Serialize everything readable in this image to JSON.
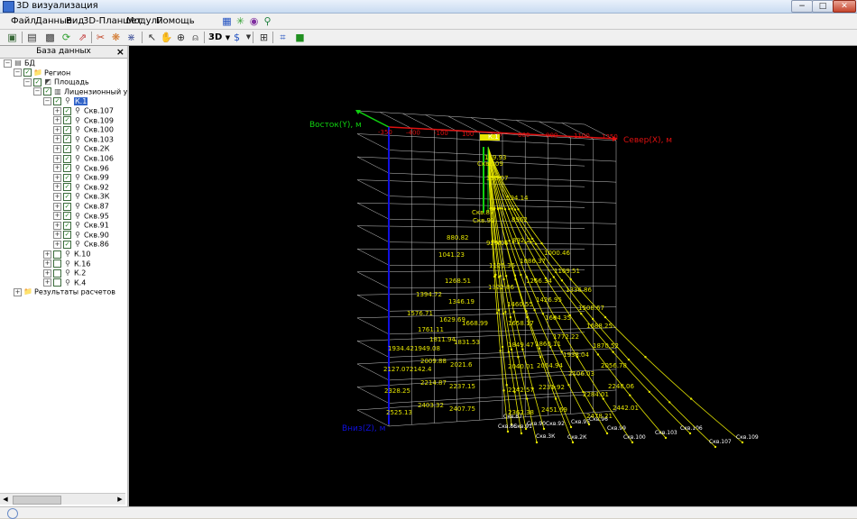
{
  "window": {
    "title": "3D визуализация",
    "app_icon": "3d-app-icon",
    "minimize": "−",
    "maximize": "□",
    "close": "✕"
  },
  "menu": {
    "items": [
      {
        "label": "Файл"
      },
      {
        "label": "Данные"
      },
      {
        "label": "Вид"
      },
      {
        "label": "3D-Планшет"
      },
      {
        "label": "Модули"
      },
      {
        "label": "Помощь"
      }
    ],
    "icons": [
      "grid-icon",
      "network-icon",
      "globe-icon",
      "wells-icon"
    ]
  },
  "toolbar": {
    "buttons": [
      "new-icon",
      "layers-icon",
      "save-icon",
      "refresh-icon",
      "export-icon",
      "cut-icon",
      "pattern-icon",
      "filter-icon",
      "pointer-icon",
      "hand-icon",
      "zoom-icon",
      "measure-icon"
    ],
    "dropdown_label": "3D",
    "dropdown_arrow": "▼",
    "extra_buttons": [
      "rotate-icon",
      "zoom-window-icon",
      "snapshot-icon",
      "print-icon",
      "color-icon"
    ]
  },
  "panel": {
    "title": "База данных",
    "close": "×",
    "tree": [
      {
        "label": "БД",
        "level": 0,
        "expander": "−",
        "icon": "database-icon",
        "checked": null
      },
      {
        "label": "Регион",
        "level": 1,
        "expander": "−",
        "icon": "folder-icon",
        "checked": true
      },
      {
        "label": "Площадь",
        "level": 2,
        "expander": "−",
        "icon": "area-icon",
        "checked": true
      },
      {
        "label": "Лицензионный участок",
        "level": 3,
        "expander": "−",
        "icon": "license-icon",
        "checked": true
      },
      {
        "label": "К.1",
        "level": 4,
        "expander": "−",
        "icon": "pad-icon",
        "checked": true,
        "selected": true
      },
      {
        "label": "Скв.107",
        "level": 5,
        "expander": "+",
        "icon": "well-icon",
        "checked": true
      },
      {
        "label": "Скв.109",
        "level": 5,
        "expander": "+",
        "icon": "well-icon",
        "checked": true
      },
      {
        "label": "Скв.100",
        "level": 5,
        "expander": "+",
        "icon": "well-icon",
        "checked": true
      },
      {
        "label": "Скв.103",
        "level": 5,
        "expander": "+",
        "icon": "well-icon",
        "checked": true
      },
      {
        "label": "Скв.2К",
        "level": 5,
        "expander": "+",
        "icon": "well-icon",
        "checked": true
      },
      {
        "label": "Скв.106",
        "level": 5,
        "expander": "+",
        "icon": "well-icon",
        "checked": true
      },
      {
        "label": "Скв.96",
        "level": 5,
        "expander": "+",
        "icon": "well-icon",
        "checked": true
      },
      {
        "label": "Скв.99",
        "level": 5,
        "expander": "+",
        "icon": "well-icon",
        "checked": true
      },
      {
        "label": "Скв.92",
        "level": 5,
        "expander": "+",
        "icon": "well-icon",
        "checked": true
      },
      {
        "label": "Скв.3К",
        "level": 5,
        "expander": "+",
        "icon": "well-icon",
        "checked": true
      },
      {
        "label": "Скв.87",
        "level": 5,
        "expander": "+",
        "icon": "well-icon",
        "checked": true
      },
      {
        "label": "Скв.95",
        "level": 5,
        "expander": "+",
        "icon": "well-icon",
        "checked": true
      },
      {
        "label": "Скв.91",
        "level": 5,
        "expander": "+",
        "icon": "well-icon",
        "checked": true
      },
      {
        "label": "Скв.90",
        "level": 5,
        "expander": "+",
        "icon": "well-icon",
        "checked": true
      },
      {
        "label": "Скв.86",
        "level": 5,
        "expander": "+",
        "icon": "well-icon",
        "checked": true
      },
      {
        "label": "К.10",
        "level": 4,
        "expander": "+",
        "icon": "pad-icon",
        "checked": false
      },
      {
        "label": "К.16",
        "level": 4,
        "expander": "+",
        "icon": "pad-icon",
        "checked": false
      },
      {
        "label": "К.2",
        "level": 4,
        "expander": "+",
        "icon": "pad-icon",
        "checked": false
      },
      {
        "label": "К.4",
        "level": 4,
        "expander": "+",
        "icon": "pad-icon",
        "checked": false
      },
      {
        "label": "Результаты расчетов",
        "level": 1,
        "expander": "+",
        "icon": "folder-icon",
        "checked": null
      }
    ]
  },
  "view3d": {
    "axis_east": "Восток(Y), м",
    "axis_north": "Север(X), м",
    "axis_depth": "Вниз(Z), м",
    "x_ticks": [
      "-350",
      "-400",
      "-100",
      "100",
      "300",
      "600",
      "900",
      "1100",
      "1350"
    ],
    "colors": {
      "background": "#000000",
      "grid": "#c8c8c8",
      "trajectory": "#e6e600",
      "x_axis": "#e01010",
      "y_axis": "#10d010",
      "z_axis": "#1010e0"
    },
    "pad_label": "К.1",
    "wells": [
      {
        "label": "Скв.87",
        "end": [
          424,
          420
        ],
        "lx": 415,
        "ly": 413
      },
      {
        "label": "Скв.86",
        "end": [
          420,
          428
        ],
        "lx": 409,
        "ly": 424
      },
      {
        "label": "Скв.90",
        "end": [
          440,
          425
        ],
        "lx": 441,
        "ly": 421
      },
      {
        "label": "Скв.92",
        "end": [
          460,
          425
        ],
        "lx": 462,
        "ly": 421
      },
      {
        "label": "Скв.3К",
        "end": [
          452,
          440
        ],
        "lx": 451,
        "ly": 435
      },
      {
        "label": "Скв.95",
        "end": [
          490,
          423
        ],
        "lx": 490,
        "ly": 419
      },
      {
        "label": "Скв.96",
        "end": [
          510,
          420
        ],
        "lx": 510,
        "ly": 416
      },
      {
        "label": "Скв.2К",
        "end": [
          492,
          440
        ],
        "lx": 486,
        "ly": 436
      },
      {
        "label": "Скв.99",
        "end": [
          530,
          430
        ],
        "lx": 530,
        "ly": 426
      },
      {
        "label": "Скв.100",
        "end": [
          558,
          440
        ],
        "lx": 548,
        "ly": 436
      },
      {
        "label": "Скв.103",
        "end": [
          595,
          435
        ],
        "lx": 583,
        "ly": 431
      },
      {
        "label": "Скв.106",
        "end": [
          622,
          430
        ],
        "lx": 611,
        "ly": 426
      },
      {
        "label": "Скв.107",
        "end": [
          650,
          445
        ],
        "lx": 643,
        "ly": 441
      },
      {
        "label": "Скв.109",
        "end": [
          680,
          440
        ],
        "lx": 673,
        "ly": 436
      },
      {
        "label": "Скв.91",
        "end": [
          435,
          430
        ],
        "lx": 426,
        "ly": 424
      }
    ],
    "depth_labels": [
      {
        "t": "119.93",
        "x": 394,
        "y": 126
      },
      {
        "t": "Скв.109",
        "x": 386,
        "y": 133
      },
      {
        "t": "310.07",
        "x": 396,
        "y": 149
      },
      {
        "t": "594.14",
        "x": 418,
        "y": 171
      },
      {
        "t": "Скв.87",
        "x": 380,
        "y": 187
      },
      {
        "t": "Скв.91",
        "x": 381,
        "y": 196
      },
      {
        "t": "8962",
        "x": 424,
        "y": 195
      },
      {
        "t": "880.82",
        "x": 352,
        "y": 215
      },
      {
        "t": "929.06",
        "x": 396,
        "y": 221
      },
      {
        "t": "892.25",
        "x": 425,
        "y": 218
      },
      {
        "t": "1000.46",
        "x": 460,
        "y": 232
      },
      {
        "t": "1041.23",
        "x": 343,
        "y": 234
      },
      {
        "t": "1086.37",
        "x": 433,
        "y": 241
      },
      {
        "t": "1125.36",
        "x": 399,
        "y": 246
      },
      {
        "t": "1169.51",
        "x": 471,
        "y": 252
      },
      {
        "t": "1268.51",
        "x": 350,
        "y": 263
      },
      {
        "t": "1266.34",
        "x": 440,
        "y": 263
      },
      {
        "t": "1336.86",
        "x": 484,
        "y": 273
      },
      {
        "t": "1322.86",
        "x": 398,
        "y": 270
      },
      {
        "t": "1394.72",
        "x": 318,
        "y": 278
      },
      {
        "t": "1346.19",
        "x": 354,
        "y": 286
      },
      {
        "t": "1426.95",
        "x": 451,
        "y": 284
      },
      {
        "t": "1460.55",
        "x": 419,
        "y": 289
      },
      {
        "t": "1508.67",
        "x": 498,
        "y": 293
      },
      {
        "t": "1576.71",
        "x": 308,
        "y": 299
      },
      {
        "t": "1629.69",
        "x": 344,
        "y": 306
      },
      {
        "t": "1668.99",
        "x": 369,
        "y": 310
      },
      {
        "t": "1604.35",
        "x": 461,
        "y": 304
      },
      {
        "t": "1658.17",
        "x": 420,
        "y": 310
      },
      {
        "t": "1688.25",
        "x": 507,
        "y": 313
      },
      {
        "t": "1761.11",
        "x": 320,
        "y": 317
      },
      {
        "t": "1772.22",
        "x": 470,
        "y": 325
      },
      {
        "t": "1811.94",
        "x": 333,
        "y": 328
      },
      {
        "t": "1831.53",
        "x": 360,
        "y": 331
      },
      {
        "t": "1849.47",
        "x": 420,
        "y": 334
      },
      {
        "t": "1860.11",
        "x": 450,
        "y": 333
      },
      {
        "t": "1870.52",
        "x": 514,
        "y": 335
      },
      {
        "t": "1934.42",
        "x": 287,
        "y": 338
      },
      {
        "t": "1949.08",
        "x": 316,
        "y": 338
      },
      {
        "t": "1938.04",
        "x": 481,
        "y": 345
      },
      {
        "t": "2009.88",
        "x": 323,
        "y": 352
      },
      {
        "t": "2021.6",
        "x": 356,
        "y": 356
      },
      {
        "t": "2040.01",
        "x": 420,
        "y": 358
      },
      {
        "t": "2064.94",
        "x": 452,
        "y": 357
      },
      {
        "t": "2056.78",
        "x": 523,
        "y": 357
      },
      {
        "t": "2127.07",
        "x": 282,
        "y": 361
      },
      {
        "t": "2142.4",
        "x": 311,
        "y": 361
      },
      {
        "t": "2106.03",
        "x": 487,
        "y": 366
      },
      {
        "t": "2214.87",
        "x": 323,
        "y": 376
      },
      {
        "t": "2237.15",
        "x": 355,
        "y": 380
      },
      {
        "t": "2242.57",
        "x": 420,
        "y": 384
      },
      {
        "t": "2231.92",
        "x": 454,
        "y": 381
      },
      {
        "t": "2284.01",
        "x": 503,
        "y": 389
      },
      {
        "t": "2248.06",
        "x": 531,
        "y": 380
      },
      {
        "t": "2328.25",
        "x": 283,
        "y": 385
      },
      {
        "t": "2403.32",
        "x": 320,
        "y": 401
      },
      {
        "t": "2407.75",
        "x": 355,
        "y": 405
      },
      {
        "t": "2362.38",
        "x": 420,
        "y": 409
      },
      {
        "t": "2451.69",
        "x": 457,
        "y": 406
      },
      {
        "t": "2478.21",
        "x": 507,
        "y": 413
      },
      {
        "t": "2442.01",
        "x": 536,
        "y": 404
      },
      {
        "t": "2525.13",
        "x": 285,
        "y": 409
      }
    ]
  }
}
